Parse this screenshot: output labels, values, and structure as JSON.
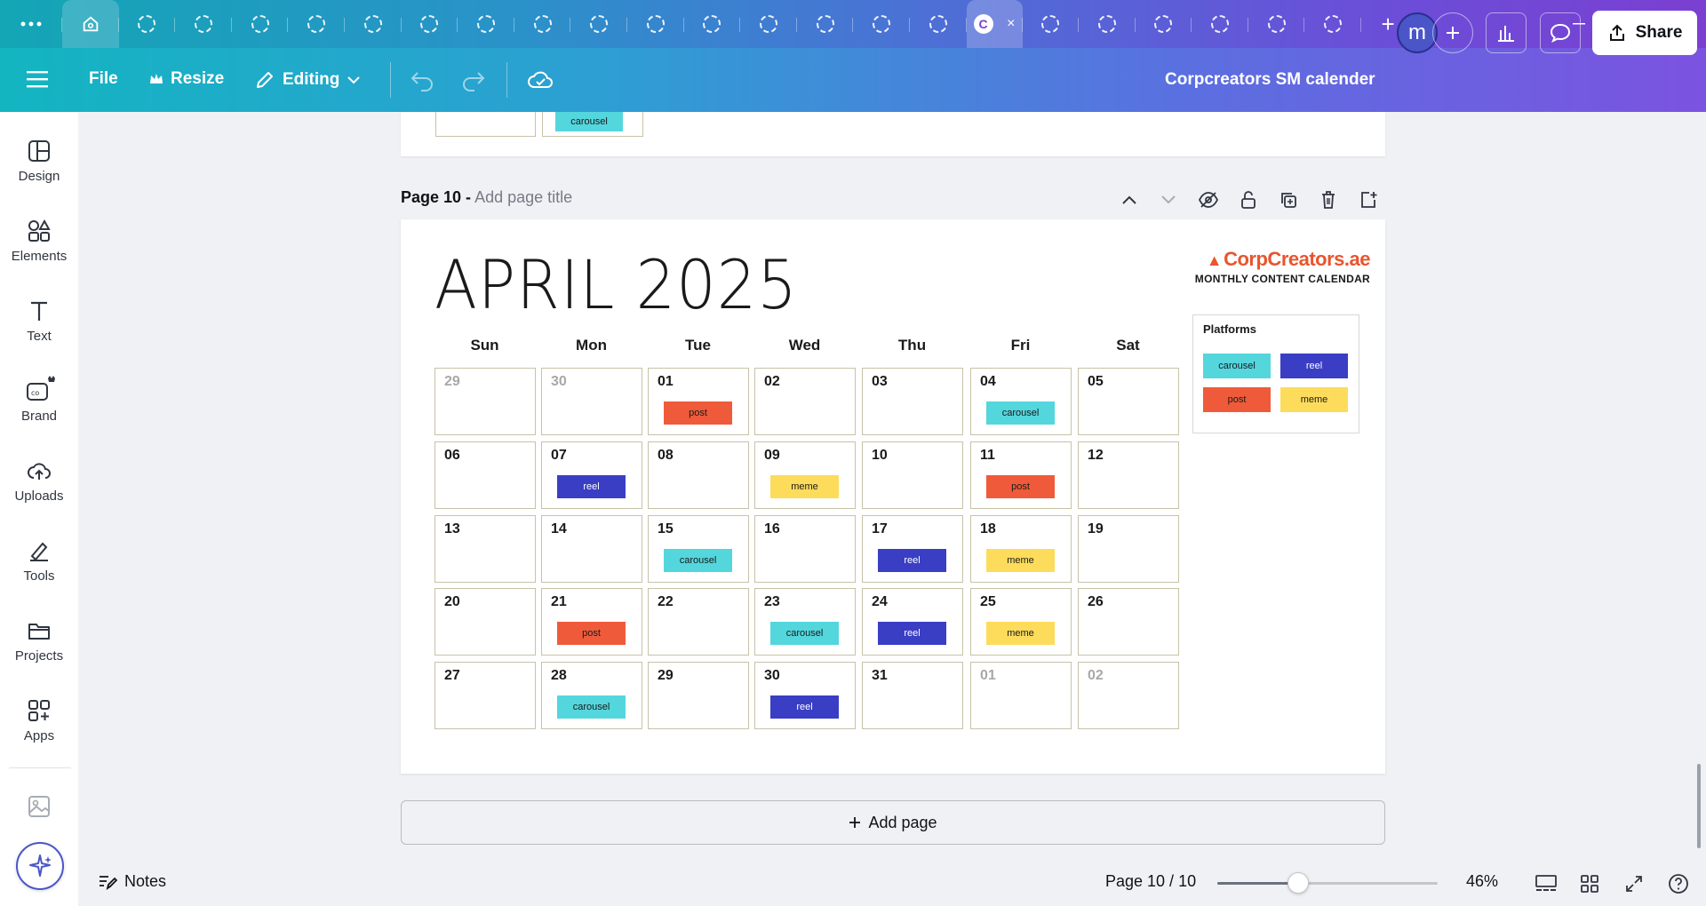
{
  "tabs": {
    "active_close": "×",
    "new_tab": "+"
  },
  "toolbar": {
    "file": "File",
    "resize": "Resize",
    "editing": "Editing",
    "doc_title": "Corpcreators SM calender",
    "avatar_letter": "m",
    "share": "Share"
  },
  "sidebar": {
    "items": [
      {
        "label": "Design",
        "icon": "design-icon"
      },
      {
        "label": "Elements",
        "icon": "elements-icon"
      },
      {
        "label": "Text",
        "icon": "text-icon"
      },
      {
        "label": "Brand",
        "icon": "brand-icon"
      },
      {
        "label": "Uploads",
        "icon": "uploads-icon"
      },
      {
        "label": "Tools",
        "icon": "tools-icon"
      },
      {
        "label": "Projects",
        "icon": "projects-icon"
      },
      {
        "label": "Apps",
        "icon": "apps-icon"
      }
    ]
  },
  "prev_page": {
    "tag": "carousel"
  },
  "page": {
    "label": "Page 10 -",
    "title_placeholder": "Add page title"
  },
  "calendar": {
    "title": "APRIL 2025",
    "brand_name": "CorpCreators.ae",
    "brand_sub": "MONTHLY CONTENT CALENDAR",
    "days": [
      "Sun",
      "Mon",
      "Tue",
      "Wed",
      "Thu",
      "Fri",
      "Sat"
    ],
    "weeks": [
      [
        {
          "n": "29",
          "muted": true
        },
        {
          "n": "30",
          "muted": true
        },
        {
          "n": "01",
          "tag": "post"
        },
        {
          "n": "02"
        },
        {
          "n": "03"
        },
        {
          "n": "04",
          "tag": "carousel"
        },
        {
          "n": "05"
        }
      ],
      [
        {
          "n": "06"
        },
        {
          "n": "07",
          "tag": "reel"
        },
        {
          "n": "08"
        },
        {
          "n": "09",
          "tag": "meme"
        },
        {
          "n": "10"
        },
        {
          "n": "11",
          "tag": "post"
        },
        {
          "n": "12"
        }
      ],
      [
        {
          "n": "13"
        },
        {
          "n": "14"
        },
        {
          "n": "15",
          "tag": "carousel"
        },
        {
          "n": "16"
        },
        {
          "n": "17",
          "tag": "reel"
        },
        {
          "n": "18",
          "tag": "meme"
        },
        {
          "n": "19"
        }
      ],
      [
        {
          "n": "20"
        },
        {
          "n": "21",
          "tag": "post"
        },
        {
          "n": "22"
        },
        {
          "n": "23",
          "tag": "carousel"
        },
        {
          "n": "24",
          "tag": "reel"
        },
        {
          "n": "25",
          "tag": "meme"
        },
        {
          "n": "26"
        }
      ],
      [
        {
          "n": "27"
        },
        {
          "n": "28",
          "tag": "carousel"
        },
        {
          "n": "29"
        },
        {
          "n": "30",
          "tag": "reel"
        },
        {
          "n": "31"
        },
        {
          "n": "01",
          "muted": true
        },
        {
          "n": "02",
          "muted": true
        }
      ]
    ],
    "legend": {
      "title": "Platforms",
      "items": [
        "carousel",
        "reel",
        "post",
        "meme"
      ]
    },
    "colors": {
      "carousel": "#54d6dd",
      "reel": "#3a3ec4",
      "post": "#ef5b3a",
      "meme": "#fddc5c"
    }
  },
  "add_page": "Add page",
  "bottom": {
    "notes": "Notes",
    "page_info": "Page 10 / 10",
    "zoom": "46%",
    "zoom_level": 0.46
  }
}
